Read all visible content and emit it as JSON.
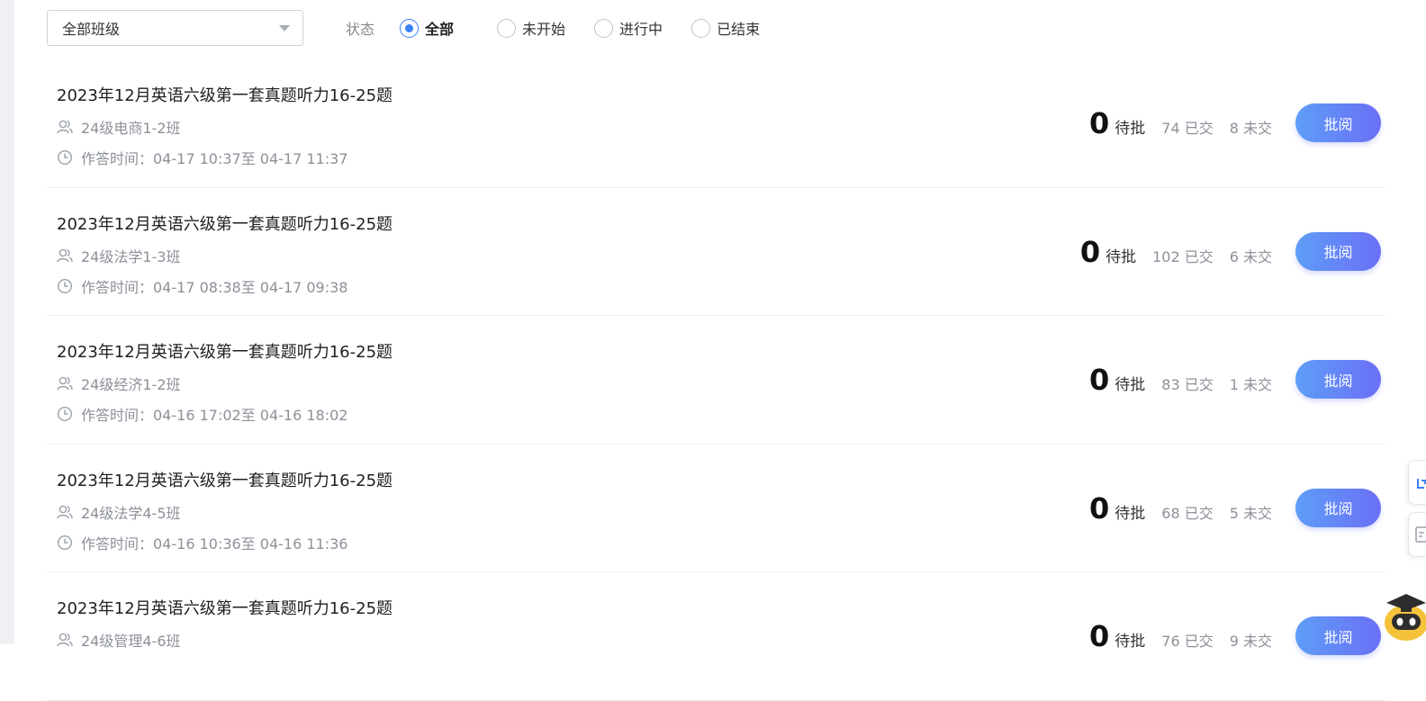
{
  "filter": {
    "class_select_value": "全部班级",
    "status_label": "状态",
    "options": [
      {
        "label": "全部",
        "checked": true
      },
      {
        "label": "未开始",
        "checked": false
      },
      {
        "label": "进行中",
        "checked": false
      },
      {
        "label": "已结束",
        "checked": false
      }
    ]
  },
  "tasks": [
    {
      "title": "2023年12月英语六级第一套真题听力16-25题",
      "class_name": "24级电商1-2班",
      "time": "作答时间：04-17 10:37至 04-17 11:37",
      "pending": "0",
      "pending_label": "待批",
      "submitted": "74 已交",
      "not_submitted": "8 未交",
      "button": "批阅"
    },
    {
      "title": "2023年12月英语六级第一套真题听力16-25题",
      "class_name": "24级法学1-3班",
      "time": "作答时间：04-17 08:38至 04-17 09:38",
      "pending": "0",
      "pending_label": "待批",
      "submitted": "102 已交",
      "not_submitted": "6 未交",
      "button": "批阅"
    },
    {
      "title": "2023年12月英语六级第一套真题听力16-25题",
      "class_name": "24级经济1-2班",
      "time": "作答时间：04-16 17:02至 04-16 18:02",
      "pending": "0",
      "pending_label": "待批",
      "submitted": "83 已交",
      "not_submitted": "1 未交",
      "button": "批阅"
    },
    {
      "title": "2023年12月英语六级第一套真题听力16-25题",
      "class_name": "24级法学4-5班",
      "time": "作答时间：04-16 10:36至 04-16 11:36",
      "pending": "0",
      "pending_label": "待批",
      "submitted": "68 已交",
      "not_submitted": "5 未交",
      "button": "批阅"
    },
    {
      "title": "2023年12月英语六级第一套真题听力16-25题",
      "class_name": "24级管理4-6班",
      "time": "",
      "pending": "0",
      "pending_label": "待批",
      "submitted": "76 已交",
      "not_submitted": "9 未交",
      "button": "批阅"
    }
  ],
  "icons": {
    "class": "users-icon",
    "time": "clock-icon",
    "select": "caret-down-icon"
  },
  "colors": {
    "accent": "#3b82f6",
    "button_start": "#5e9df7",
    "button_end": "#6b6ff5",
    "muted_text": "#8c9099"
  }
}
